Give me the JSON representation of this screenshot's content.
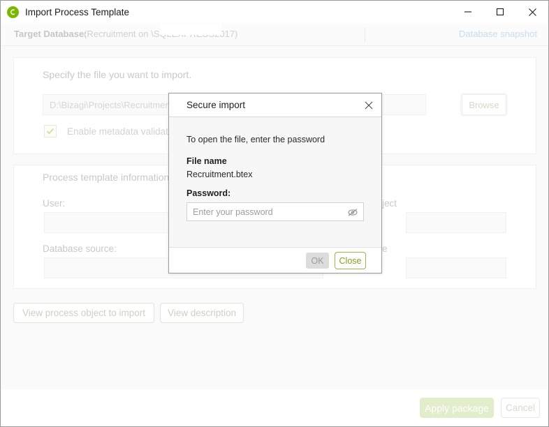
{
  "window": {
    "title": "Import Process Template",
    "icon": "bizagi-logo-icon",
    "controls": {
      "minimize": "minimize-icon",
      "maximize": "maximize-icon",
      "close": "close-icon"
    }
  },
  "target_database": {
    "label": "Target Database:",
    "value": "(Recruitment on                          \\SQLEXPRESS2017)",
    "snapshot_link": "Database snapshot"
  },
  "file_section": {
    "title": "Specify the file you want to import.",
    "file_path_placeholder": "D:\\Bizagi\\Projects\\Recruitment",
    "file_path_value": "",
    "browse_label": "Browse",
    "metadata_checkbox_label": "Enable metadata validation",
    "metadata_checkbox_checked": true
  },
  "info_section": {
    "title": "Process template information",
    "user_label": "User:",
    "user_value": "",
    "project_label": "Project",
    "project_value": "",
    "database_source_label": "Database source:",
    "database_source_value": "",
    "date_label": "Date",
    "date_value": ""
  },
  "actions": {
    "view_object_label": "View process object to import",
    "view_description_label": "View description"
  },
  "footer": {
    "apply_label": "Apply package",
    "cancel_label": "Cancel"
  },
  "modal": {
    "title": "Secure import",
    "close_icon": "close-icon",
    "intro": "To open the file, enter the password",
    "file_name_label": "File name",
    "file_name_value": "Recruitment.btex",
    "password_label": "Password:",
    "password_placeholder": "Enter your password",
    "password_value": "",
    "eye_icon": "eye-off-icon",
    "ok_label": "OK",
    "close_label": "Close"
  },
  "colors": {
    "brand_green": "#7ab800",
    "accent_olive": "#86a020",
    "apply_bg": "#e2edcb",
    "link_blue": "#c7dcf2"
  }
}
